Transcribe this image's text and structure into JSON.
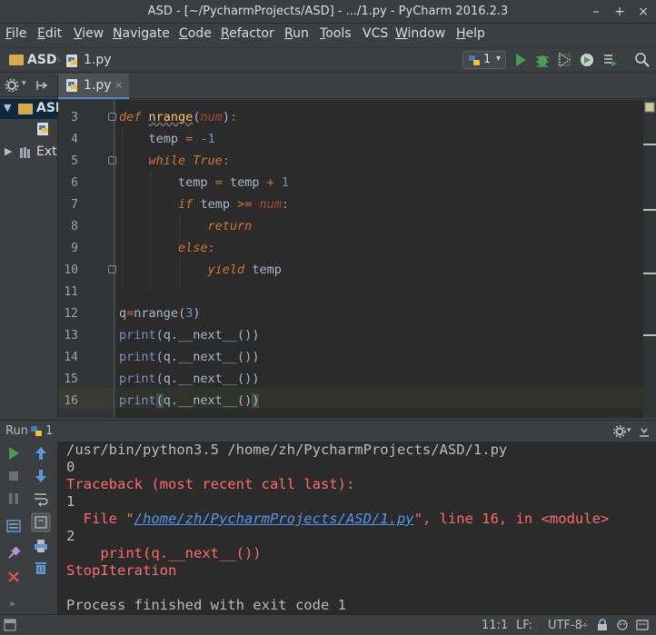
{
  "window": {
    "title": "ASD - [~/PycharmProjects/ASD] - .../1.py - PyCharm 2016.2.3",
    "controls": [
      "–",
      "+",
      "×"
    ]
  },
  "menu": [
    {
      "u": "F",
      "rest": "ile"
    },
    {
      "u": "E",
      "rest": "dit"
    },
    {
      "u": "V",
      "rest": "iew"
    },
    {
      "u": "N",
      "rest": "avigate"
    },
    {
      "u": "C",
      "rest": "ode"
    },
    {
      "u": "R",
      "rest": "efactor"
    },
    {
      "u": "R",
      "rest": "un"
    },
    {
      "u": "T",
      "rest": "ools"
    },
    {
      "u": "",
      "rest": "VCS"
    },
    {
      "u": "W",
      "rest": "indow"
    },
    {
      "u": "H",
      "rest": "elp"
    }
  ],
  "breadcrumb": {
    "project": "ASD",
    "file": "1.py"
  },
  "run_config": {
    "label": "1"
  },
  "project_tree": {
    "root": "ASD",
    "external": "Ext"
  },
  "editor_tab": {
    "label": "1.py",
    "close": "×"
  },
  "editor": {
    "line_numbers": [
      "3",
      "4",
      "5",
      "6",
      "7",
      "8",
      "9",
      "10",
      "11",
      "12",
      "13",
      "14",
      "15",
      "16"
    ],
    "tokens": {
      "def": "def",
      "nrange": "nrange",
      "num": "num",
      "temp": "temp",
      "assign": "=",
      "neg1": "-1",
      "while": "while",
      "true": "True",
      "colon": ":",
      "plus": "+",
      "one": "1",
      "if": "if",
      "ge": ">=",
      "return": "return",
      "else": "else",
      "yield": "yield",
      "q": "q",
      "three": "3",
      "print": "print",
      "next": "q.__next__()",
      "lparen": "(",
      "rparen": ")"
    }
  },
  "run_panel": {
    "title": "Run",
    "config": "1",
    "output": [
      "/usr/bin/python3.5 /home/zh/PycharmProjects/ASD/1.py",
      "0",
      "Traceback (most recent call last):",
      "1",
      "2",
      "    print(q.__next__())",
      "StopIteration",
      "",
      "Process finished with exit code 1"
    ],
    "file_line": {
      "prefix": "  File \"",
      "link": "/home/zh/PycharmProjects/ASD/1.py",
      "suffix": "\", line 16, in <module>"
    }
  },
  "status_bar": {
    "position": "11:1",
    "line_sep": "LF:",
    "encoding": "UTF-8"
  },
  "colors": {
    "keyword": "#cc7832",
    "function": "#ffc66d",
    "number": "#6897bb",
    "error": "#ff6b68",
    "link": "#5394ec",
    "run_green": "#499c54"
  }
}
